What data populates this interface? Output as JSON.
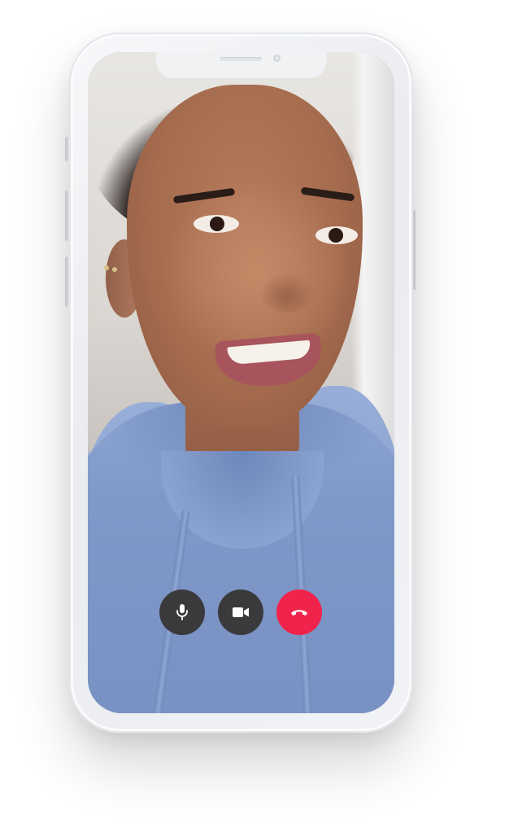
{
  "app": {
    "screen": "video-call"
  },
  "call_controls": {
    "buttons": [
      {
        "id": "mute",
        "icon": "microphone-icon"
      },
      {
        "id": "video",
        "icon": "video-camera-icon"
      },
      {
        "id": "end",
        "icon": "phone-hangup-icon"
      }
    ]
  },
  "colors": {
    "control_dark": "#3a3a3c",
    "end_call": "#f0234c",
    "icon": "#ffffff",
    "device_frame": "#eceef1"
  }
}
